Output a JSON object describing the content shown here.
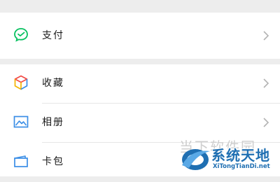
{
  "menu": {
    "groups": [
      {
        "items": [
          {
            "label": "支付",
            "icon": "wechat-pay-icon",
            "has_chevron": true
          }
        ]
      },
      {
        "items": [
          {
            "label": "收藏",
            "icon": "favorites-cube-icon",
            "has_chevron": true
          },
          {
            "label": "相册",
            "icon": "album-image-icon",
            "has_chevron": true
          },
          {
            "label": "卡包",
            "icon": "card-wallet-icon",
            "has_chevron": false
          }
        ]
      }
    ]
  },
  "watermark": {
    "faint_text": "当下软件园",
    "title": "系统天地",
    "url": "XiTongTianDi.net"
  },
  "colors": {
    "background": "#ededed",
    "pay_green": "#07c160",
    "album_blue": "#3a8ee6",
    "watermark_blue": "#1f6fb2"
  }
}
